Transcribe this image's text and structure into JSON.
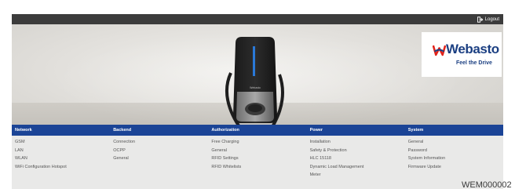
{
  "header": {
    "logout_label": "Logout"
  },
  "brand": {
    "name": "Webasto",
    "slogan": "Feel the Drive",
    "primary_color": "#1b3f82",
    "accent_color": "#e2231a",
    "nav_color": "#1b4496"
  },
  "charger": {
    "badge": "Webasto"
  },
  "nav": [
    {
      "label": "Network",
      "items": [
        "GSM",
        "LAN",
        "WLAN",
        "WiFi Configuration Hotspot"
      ]
    },
    {
      "label": "Backend",
      "items": [
        "Connection",
        "OCPP",
        "General"
      ]
    },
    {
      "label": "Authorization",
      "items": [
        "Free Charging",
        "General",
        "RFID Settings",
        "RFID Whitelists"
      ]
    },
    {
      "label": "Power",
      "items": [
        "Installation",
        "Safety & Protection",
        "HLC 15118",
        "Dynamic Load Management",
        "Meter"
      ]
    },
    {
      "label": "System",
      "items": [
        "General",
        "Password",
        "System Information",
        "Firmware Update"
      ]
    }
  ],
  "watermark": "WEM000002"
}
